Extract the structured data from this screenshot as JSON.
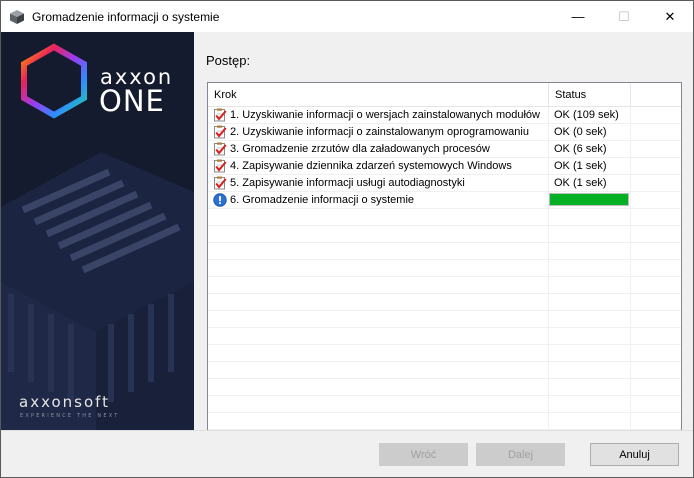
{
  "window": {
    "title": "Gromadzenie informacji o systemie",
    "controls": {
      "minimize": "—",
      "maximize": "☐",
      "close": "✕"
    }
  },
  "banner": {
    "logo_line1": "axxon",
    "logo_line2": "ONE",
    "company": "axxonsoft",
    "tagline": "EXPERIENCE THE NEXT"
  },
  "content": {
    "progress_label": "Postęp:",
    "columns": {
      "step": "Krok",
      "status": "Status"
    },
    "rows": [
      {
        "icon": "checklist-icon",
        "step": "1. Uzyskiwanie informacji o wersjach zainstalowanych modułów",
        "status": "OK (109 sek)"
      },
      {
        "icon": "checklist-icon",
        "step": "2. Uzyskiwanie informacji o zainstalowanym oprogramowaniu",
        "status": "OK (0 sek)"
      },
      {
        "icon": "checklist-icon",
        "step": "3. Gromadzenie zrzutów dla załadowanych procesów",
        "status": "OK (6 sek)"
      },
      {
        "icon": "checklist-icon",
        "step": "4. Zapisywanie dziennika zdarzeń systemowych Windows",
        "status": "OK (1 sek)"
      },
      {
        "icon": "checklist-icon",
        "step": "5. Zapisywanie informacji usługi autodiagnostyki",
        "status": "OK (1 sek)"
      },
      {
        "icon": "info-icon",
        "step": "6. Gromadzenie informacji o systemie",
        "status": "",
        "progress": 1.0
      }
    ],
    "empty_rows": 13
  },
  "buttons": {
    "back": "Wróć",
    "next": "Dalej",
    "cancel": "Anuluj"
  },
  "colors": {
    "banner_bg": "#141b2e",
    "progress_fill": "#06b025"
  }
}
